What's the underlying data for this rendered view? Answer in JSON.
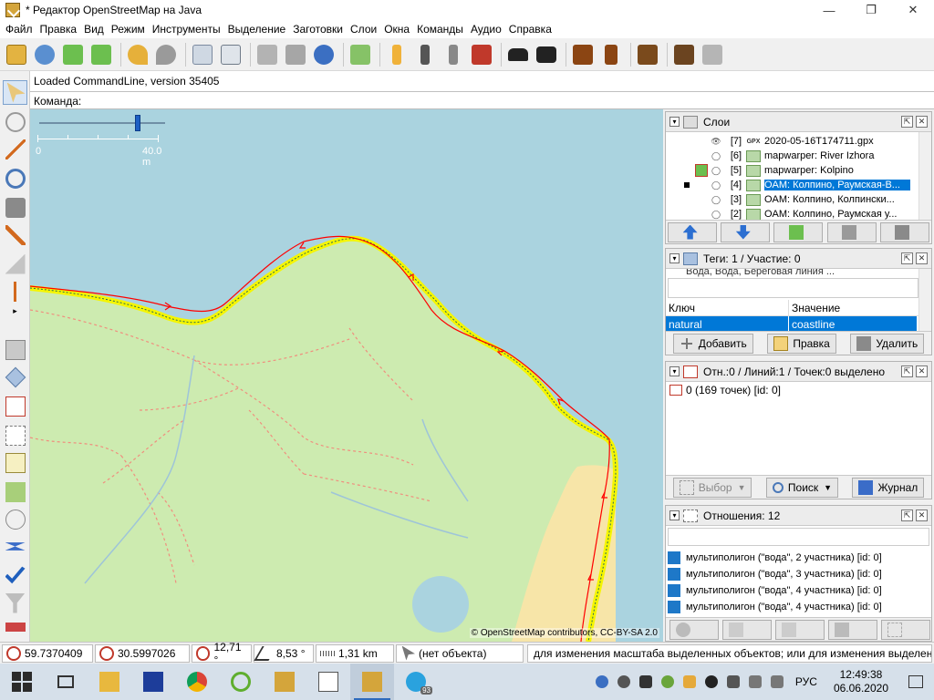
{
  "window": {
    "title": "* Редактор OpenStreetMap на Java",
    "minimize": "—",
    "maximize": "❐",
    "close": "✕"
  },
  "menu": [
    "Файл",
    "Правка",
    "Вид",
    "Режим",
    "Инструменты",
    "Выделение",
    "Заготовки",
    "Слои",
    "Окна",
    "Команды",
    "Аудио",
    "Справка"
  ],
  "command": {
    "log": "Loaded CommandLine, version 35405",
    "label": "Команда:",
    "value": ""
  },
  "map": {
    "scale_left": "0",
    "scale_right": "40.0 m",
    "attribution": "© OpenStreetMap contributors, CC-BY-SA 2.0",
    "colors": {
      "water": "#aad3df",
      "land": "#cdebb0",
      "sand": "#f7e5a8",
      "way": "#ff0000",
      "selected": "#f5f500"
    }
  },
  "layers": {
    "title": "Слои",
    "items": [
      {
        "index": "[7]",
        "type": "GPX",
        "name": "2020-05-16T174711.gpx",
        "visible": true,
        "selected": false
      },
      {
        "index": "[6]",
        "type": "img",
        "name": "mapwarper: River Izhora",
        "visible": false,
        "selected": false
      },
      {
        "index": "[5]",
        "type": "img",
        "name": "mapwarper: Kolpino",
        "visible": false,
        "selected": false
      },
      {
        "index": "[4]",
        "type": "img",
        "name": "OAM: Колпино, Раумская-В...",
        "visible": false,
        "selected": true
      },
      {
        "index": "[3]",
        "type": "img",
        "name": "OAM: Колпино, Колпински...",
        "visible": false,
        "selected": false
      },
      {
        "index": "[2]",
        "type": "img",
        "name": "OAM: Колпино, Раумская у...",
        "visible": false,
        "selected": false
      }
    ]
  },
  "tags": {
    "title": "Теги: 1 / Участие: 0",
    "preset": "Вода, Вода, Береговая линия ...",
    "col_key": "Ключ",
    "col_value": "Значение",
    "rows": [
      {
        "key": "natural",
        "value": "coastline"
      }
    ],
    "add": "Добавить",
    "edit": "Правка",
    "delete": "Удалить"
  },
  "selection": {
    "title": "Отн.:0 / Линий:1 / Точек:0 выделено",
    "items": [
      "0 (169 точек) [id: 0]"
    ],
    "select": "Выбор",
    "search": "Поиск",
    "history": "Журнал"
  },
  "relations": {
    "title": "Отношения: 12",
    "filter": "",
    "items": [
      "мультиполигон (\"вода\", 2 участника) [id: 0]",
      "мультиполигон (\"вода\", 3 участника) [id: 0]",
      "мультиполигон (\"вода\", 4 участника) [id: 0]",
      "мультиполигон (\"вода\", 4 участника) [id: 0]"
    ]
  },
  "status": {
    "lat": "59.7370409",
    "lon": "30.5997026",
    "heading": "12,71 °",
    "angle": "8,53 °",
    "length": "1,31 km",
    "object": "(нет объекта)",
    "help": "для изменения масштаба выделенных объектов; или для изменения выделения"
  },
  "taskbar": {
    "lang": "РУС",
    "time": "12:49:38",
    "date": "06.06.2020",
    "telegram_badge": "93"
  }
}
